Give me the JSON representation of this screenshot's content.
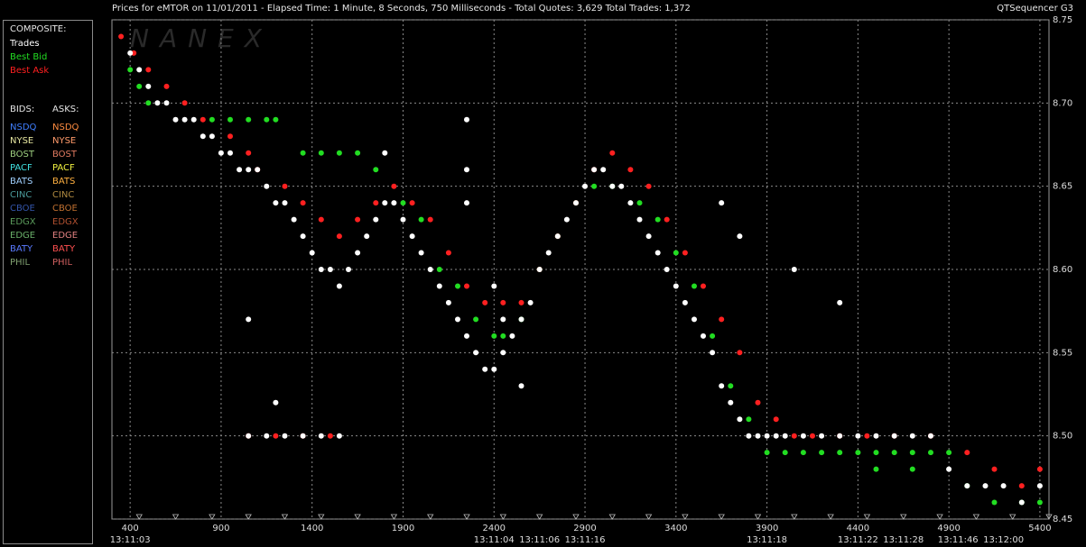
{
  "header": {
    "title": "Prices for  eMTOR  on  11/01/2011  -  Elapsed Time: 1 Minute, 8 Seconds, 750 Milliseconds  -  Total Quotes: 3,629  Total Trades: 1,372",
    "brand": "QTSequencer G3",
    "watermark": "NANEX"
  },
  "legend": {
    "composite_label": "COMPOSITE:",
    "composite_items": [
      {
        "label": "Trades",
        "color": "#ffffff"
      },
      {
        "label": "Best Bid",
        "color": "#22dd22"
      },
      {
        "label": "Best Ask",
        "color": "#ff2020"
      }
    ],
    "bids_label": "BIDS:",
    "asks_label": "ASKS:",
    "exchanges": [
      {
        "bid": "NSDQ",
        "ask": "NSDQ",
        "bid_color": "#3f7fff",
        "ask_color": "#ff8c40"
      },
      {
        "bid": "NYSE",
        "ask": "NYSE",
        "bid_color": "#e6e6a0",
        "ask_color": "#ff9a6a"
      },
      {
        "bid": "BOST",
        "ask": "BOST",
        "bid_color": "#9fd080",
        "ask_color": "#e07a60"
      },
      {
        "bid": "PACF",
        "ask": "PACF",
        "bid_color": "#40e0e0",
        "ask_color": "#f0f040"
      },
      {
        "bid": "BATS",
        "ask": "BATS",
        "bid_color": "#a0d0ff",
        "ask_color": "#ffb040"
      },
      {
        "bid": "CINC",
        "ask": "CINC",
        "bid_color": "#4a9a9a",
        "ask_color": "#b08a40"
      },
      {
        "bid": "CBOE",
        "ask": "CBOE",
        "bid_color": "#3355aa",
        "ask_color": "#c07030"
      },
      {
        "bid": "EDGX",
        "ask": "EDGX",
        "bid_color": "#5a9a5a",
        "ask_color": "#b05030"
      },
      {
        "bid": "EDGE",
        "ask": "EDGE",
        "bid_color": "#6ab06a",
        "ask_color": "#e08080"
      },
      {
        "bid": "BATY",
        "ask": "BATY",
        "bid_color": "#5a7aff",
        "ask_color": "#ff5050"
      },
      {
        "bid": "PHIL",
        "ask": "PHIL",
        "bid_color": "#80a070",
        "ask_color": "#d06060"
      }
    ]
  },
  "chart_data": {
    "type": "scatter",
    "title": "Prices for  eMTOR  on  11/01/2011",
    "xlim": [
      300,
      5450
    ],
    "ylim": [
      8.45,
      8.75
    ],
    "grid": true,
    "y_ticks": [
      "8.75",
      "8.70",
      "8.65",
      "8.60",
      "8.55",
      "8.50",
      "8.45"
    ],
    "y_tick_values": [
      8.75,
      8.7,
      8.65,
      8.6,
      8.55,
      8.5,
      8.45
    ],
    "x_ticks": [
      "400",
      "900",
      "1400",
      "1900",
      "2400",
      "2900",
      "3400",
      "3900",
      "4400",
      "4900",
      "5400"
    ],
    "x_tick_values": [
      400,
      900,
      1400,
      1900,
      2400,
      2900,
      3400,
      3900,
      4400,
      4900,
      5400
    ],
    "time_labels": [
      {
        "x": 400,
        "label": "13:11:03"
      },
      {
        "x": 2400,
        "label": "13:11:04"
      },
      {
        "x": 2650,
        "label": "13:11:06"
      },
      {
        "x": 2900,
        "label": "13:11:16"
      },
      {
        "x": 3900,
        "label": "13:11:18"
      },
      {
        "x": 4400,
        "label": "13:11:22"
      },
      {
        "x": 4650,
        "label": "13:11:28"
      },
      {
        "x": 4950,
        "label": "13:11:46"
      },
      {
        "x": 5200,
        "label": "13:12:00"
      }
    ],
    "series": [
      {
        "name": "Trades",
        "color": "#ffffff",
        "points": [
          [
            400,
            8.73
          ],
          [
            450,
            8.72
          ],
          [
            500,
            8.71
          ],
          [
            550,
            8.7
          ],
          [
            600,
            8.7
          ],
          [
            650,
            8.69
          ],
          [
            700,
            8.69
          ],
          [
            750,
            8.69
          ],
          [
            800,
            8.68
          ],
          [
            850,
            8.68
          ],
          [
            900,
            8.67
          ],
          [
            950,
            8.67
          ],
          [
            1000,
            8.66
          ],
          [
            1050,
            8.66
          ],
          [
            1100,
            8.66
          ],
          [
            1150,
            8.65
          ],
          [
            1200,
            8.64
          ],
          [
            1250,
            8.64
          ],
          [
            1300,
            8.63
          ],
          [
            1350,
            8.62
          ],
          [
            1400,
            8.61
          ],
          [
            1450,
            8.6
          ],
          [
            1500,
            8.6
          ],
          [
            1550,
            8.59
          ],
          [
            1600,
            8.6
          ],
          [
            1650,
            8.61
          ],
          [
            1700,
            8.62
          ],
          [
            1750,
            8.63
          ],
          [
            1800,
            8.64
          ],
          [
            1850,
            8.64
          ],
          [
            1900,
            8.63
          ],
          [
            1950,
            8.62
          ],
          [
            2000,
            8.61
          ],
          [
            2050,
            8.6
          ],
          [
            2100,
            8.59
          ],
          [
            2150,
            8.58
          ],
          [
            2200,
            8.57
          ],
          [
            2250,
            8.56
          ],
          [
            2300,
            8.55
          ],
          [
            2350,
            8.54
          ],
          [
            2400,
            8.54
          ],
          [
            2450,
            8.55
          ],
          [
            2500,
            8.56
          ],
          [
            2550,
            8.57
          ],
          [
            2600,
            8.58
          ],
          [
            2650,
            8.6
          ],
          [
            2700,
            8.61
          ],
          [
            2750,
            8.62
          ],
          [
            2800,
            8.63
          ],
          [
            2850,
            8.64
          ],
          [
            2900,
            8.65
          ],
          [
            2950,
            8.66
          ],
          [
            3000,
            8.66
          ],
          [
            3050,
            8.65
          ],
          [
            3100,
            8.65
          ],
          [
            3150,
            8.64
          ],
          [
            3200,
            8.63
          ],
          [
            3250,
            8.62
          ],
          [
            3300,
            8.61
          ],
          [
            3350,
            8.6
          ],
          [
            3400,
            8.59
          ],
          [
            3450,
            8.58
          ],
          [
            3500,
            8.57
          ],
          [
            3550,
            8.56
          ],
          [
            3600,
            8.55
          ],
          [
            3650,
            8.53
          ],
          [
            3700,
            8.52
          ],
          [
            3750,
            8.51
          ],
          [
            3800,
            8.5
          ],
          [
            3850,
            8.5
          ],
          [
            3900,
            8.5
          ],
          [
            3950,
            8.5
          ],
          [
            4000,
            8.5
          ],
          [
            4100,
            8.5
          ],
          [
            4200,
            8.5
          ],
          [
            4300,
            8.5
          ],
          [
            4400,
            8.5
          ],
          [
            4500,
            8.5
          ],
          [
            4600,
            8.5
          ],
          [
            4700,
            8.5
          ],
          [
            4800,
            8.5
          ],
          [
            4900,
            8.48
          ],
          [
            5000,
            8.47
          ],
          [
            5100,
            8.47
          ],
          [
            5200,
            8.47
          ],
          [
            5300,
            8.46
          ],
          [
            5400,
            8.47
          ],
          [
            1050,
            8.5
          ],
          [
            1150,
            8.5
          ],
          [
            1250,
            8.5
          ],
          [
            1350,
            8.5
          ],
          [
            1450,
            8.5
          ],
          [
            1550,
            8.5
          ],
          [
            1800,
            8.67
          ],
          [
            1050,
            8.57
          ],
          [
            1200,
            8.52
          ],
          [
            2250,
            8.69
          ],
          [
            2250,
            8.66
          ],
          [
            2250,
            8.64
          ],
          [
            3650,
            8.64
          ],
          [
            3750,
            8.62
          ],
          [
            4050,
            8.6
          ],
          [
            4300,
            8.58
          ],
          [
            2400,
            8.59
          ],
          [
            2450,
            8.57
          ],
          [
            2550,
            8.53
          ]
        ]
      },
      {
        "name": "Best Bid",
        "color": "#22dd22",
        "points": [
          [
            400,
            8.72
          ],
          [
            450,
            8.71
          ],
          [
            500,
            8.7
          ],
          [
            850,
            8.69
          ],
          [
            950,
            8.69
          ],
          [
            1050,
            8.69
          ],
          [
            1150,
            8.69
          ],
          [
            1200,
            8.69
          ],
          [
            1350,
            8.67
          ],
          [
            1450,
            8.67
          ],
          [
            1550,
            8.67
          ],
          [
            1650,
            8.67
          ],
          [
            1750,
            8.66
          ],
          [
            1900,
            8.64
          ],
          [
            2000,
            8.63
          ],
          [
            2100,
            8.6
          ],
          [
            2200,
            8.59
          ],
          [
            2300,
            8.57
          ],
          [
            2400,
            8.56
          ],
          [
            2450,
            8.56
          ],
          [
            2550,
            8.57
          ],
          [
            2650,
            8.6
          ],
          [
            2750,
            8.62
          ],
          [
            2850,
            8.64
          ],
          [
            2950,
            8.65
          ],
          [
            3050,
            8.65
          ],
          [
            3200,
            8.64
          ],
          [
            3300,
            8.63
          ],
          [
            3400,
            8.61
          ],
          [
            3500,
            8.59
          ],
          [
            3600,
            8.56
          ],
          [
            3700,
            8.53
          ],
          [
            3800,
            8.51
          ],
          [
            3900,
            8.49
          ],
          [
            4000,
            8.49
          ],
          [
            4100,
            8.49
          ],
          [
            4200,
            8.49
          ],
          [
            4300,
            8.49
          ],
          [
            4400,
            8.49
          ],
          [
            4500,
            8.49
          ],
          [
            4600,
            8.49
          ],
          [
            4700,
            8.49
          ],
          [
            4800,
            8.49
          ],
          [
            4900,
            8.49
          ],
          [
            4500,
            8.48
          ],
          [
            4700,
            8.48
          ],
          [
            5000,
            8.47
          ],
          [
            5150,
            8.46
          ],
          [
            5300,
            8.46
          ],
          [
            5400,
            8.46
          ]
        ]
      },
      {
        "name": "Best Ask",
        "color": "#ff2020",
        "points": [
          [
            350,
            8.74
          ],
          [
            420,
            8.73
          ],
          [
            500,
            8.72
          ],
          [
            600,
            8.71
          ],
          [
            700,
            8.7
          ],
          [
            800,
            8.69
          ],
          [
            950,
            8.68
          ],
          [
            1050,
            8.67
          ],
          [
            1100,
            8.66
          ],
          [
            1250,
            8.65
          ],
          [
            1350,
            8.64
          ],
          [
            1450,
            8.63
          ],
          [
            1550,
            8.62
          ],
          [
            1650,
            8.63
          ],
          [
            1750,
            8.64
          ],
          [
            1850,
            8.65
          ],
          [
            1950,
            8.64
          ],
          [
            2050,
            8.63
          ],
          [
            2150,
            8.61
          ],
          [
            2250,
            8.59
          ],
          [
            2350,
            8.58
          ],
          [
            2450,
            8.58
          ],
          [
            2550,
            8.58
          ],
          [
            2650,
            8.6
          ],
          [
            2750,
            8.62
          ],
          [
            2850,
            8.64
          ],
          [
            2950,
            8.66
          ],
          [
            3050,
            8.67
          ],
          [
            3150,
            8.66
          ],
          [
            3250,
            8.65
          ],
          [
            3350,
            8.63
          ],
          [
            3450,
            8.61
          ],
          [
            3550,
            8.59
          ],
          [
            3650,
            8.57
          ],
          [
            3750,
            8.55
          ],
          [
            3850,
            8.52
          ],
          [
            3950,
            8.51
          ],
          [
            4050,
            8.5
          ],
          [
            4150,
            8.5
          ],
          [
            4300,
            8.5
          ],
          [
            4450,
            8.5
          ],
          [
            4600,
            8.5
          ],
          [
            4800,
            8.5
          ],
          [
            5000,
            8.49
          ],
          [
            5150,
            8.48
          ],
          [
            5300,
            8.47
          ],
          [
            5400,
            8.48
          ],
          [
            1050,
            8.5
          ],
          [
            1200,
            8.5
          ],
          [
            1350,
            8.5
          ],
          [
            1500,
            8.5
          ]
        ]
      }
    ]
  }
}
